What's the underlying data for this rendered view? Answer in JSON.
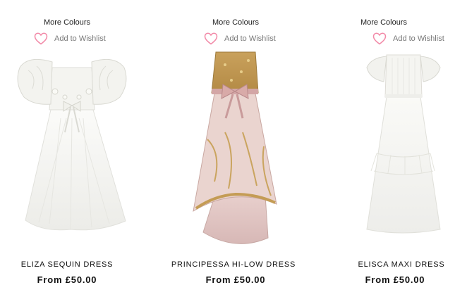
{
  "products": [
    {
      "more_colours": "More Colours",
      "wishlist_label": "Add to Wishlist",
      "name": "ELIZA SEQUIN DRESS",
      "price": "From £50.00",
      "image_icon": "white-flower-girl-dress-with-cape-sleeves"
    },
    {
      "more_colours": "More Colours",
      "wishlist_label": "Add to Wishlist",
      "name": "PRINCIPESSA HI-LOW DRESS",
      "price": "From £50.00",
      "image_icon": "pink-gold-sequin-hi-low-dress-with-bow"
    },
    {
      "more_colours": "More Colours",
      "wishlist_label": "Add to Wishlist",
      "name": "ELISCA MAXI DRESS",
      "price": "From £50.00",
      "image_icon": "white-lace-maxi-dress-with-ruffle-sleeves"
    }
  ],
  "colors": {
    "heart": "#f28aa8",
    "text": "#111111",
    "muted": "#777777"
  }
}
